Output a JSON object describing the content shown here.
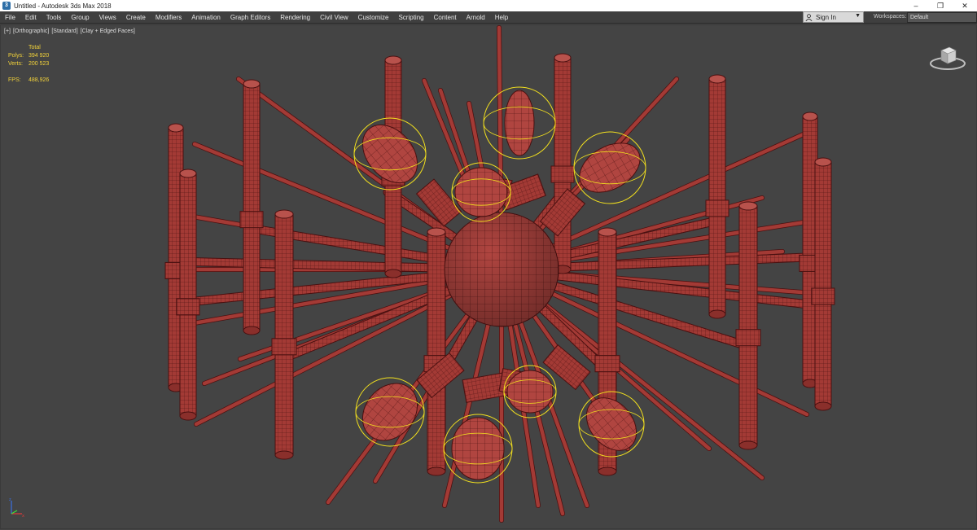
{
  "window": {
    "title": "Untitled - Autodesk 3ds Max 2018",
    "controls": [
      "minimize",
      "maximize",
      "close"
    ]
  },
  "menu": [
    {
      "label": "File"
    },
    {
      "label": "Edit"
    },
    {
      "label": "Tools"
    },
    {
      "label": "Group"
    },
    {
      "label": "Views"
    },
    {
      "label": "Create"
    },
    {
      "label": "Modifiers"
    },
    {
      "label": "Animation"
    },
    {
      "label": "Graph Editors"
    },
    {
      "label": "Rendering"
    },
    {
      "label": "Civil View"
    },
    {
      "label": "Customize"
    },
    {
      "label": "Scripting"
    },
    {
      "label": "Content"
    },
    {
      "label": "Arnold"
    },
    {
      "label": "Help"
    }
  ],
  "signin": {
    "label": "Sign In",
    "icon": "user-icon"
  },
  "workspace": {
    "label": "Workspaces:",
    "value": "Default"
  },
  "viewport": {
    "label_parts": [
      "[+]",
      "[Orthographic]",
      "[Standard]",
      "[Clay + Edged Faces]"
    ],
    "stats": {
      "header": "Total",
      "polys_label": "Polys:",
      "polys_value": "394 920",
      "verts_label": "Verts:",
      "verts_value": "200 523",
      "fps_label": "FPS:",
      "fps_value": "488,926"
    }
  },
  "colors": {
    "viewport_bg": "#444444",
    "model": "#a33a35",
    "wire": "#4a1010",
    "selection_gizmo": "#f2e01e",
    "stats_text": "#f2d23a",
    "menubar_bg": "#3f3f3f"
  },
  "icons": {
    "app": "3ds-max-icon",
    "viewcube": "viewcube-icon",
    "axis": "axis-tripod-icon"
  }
}
